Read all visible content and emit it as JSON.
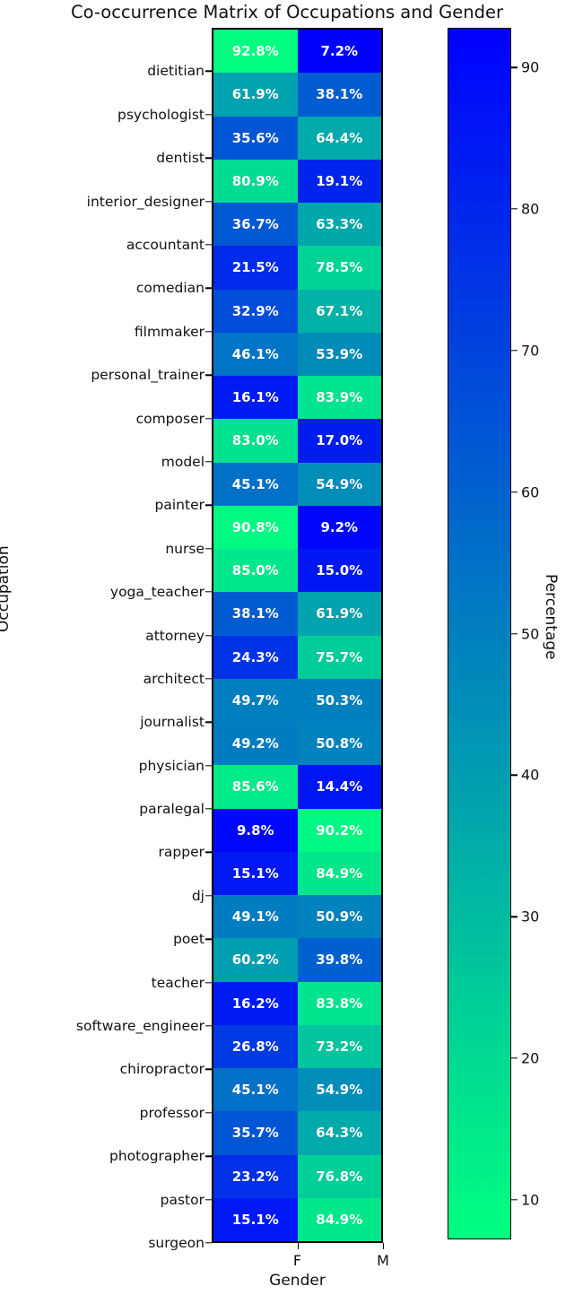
{
  "title": "Co-occurrence Matrix of Occupations and Gender",
  "axes": {
    "xlabel": "Gender",
    "ylabel": "Occupation",
    "colorbar_label": "Percentage"
  },
  "chart_data": {
    "type": "heatmap",
    "title": "Co-occurrence Matrix of Occupations and Gender",
    "xlabel": "Gender",
    "ylabel": "Occupation",
    "colorbar_label": "Percentage",
    "colormap": "winter_r",
    "grid": false,
    "legend_position": "right",
    "vmin": 7.2,
    "vmax": 92.8,
    "colorbar_ticks": [
      90,
      80,
      70,
      60,
      50,
      40,
      30,
      20,
      10
    ],
    "columns": [
      "F",
      "M"
    ],
    "rows": [
      "dietitian",
      "psychologist",
      "dentist",
      "interior_designer",
      "accountant",
      "comedian",
      "filmmaker",
      "personal_trainer",
      "composer",
      "model",
      "painter",
      "nurse",
      "yoga_teacher",
      "attorney",
      "architect",
      "journalist",
      "physician",
      "paralegal",
      "rapper",
      "dj",
      "poet",
      "teacher",
      "software_engineer",
      "chiropractor",
      "professor",
      "photographer",
      "pastor",
      "surgeon"
    ],
    "values": [
      [
        92.8,
        7.2
      ],
      [
        61.9,
        38.1
      ],
      [
        35.6,
        64.4
      ],
      [
        80.9,
        19.1
      ],
      [
        36.7,
        63.3
      ],
      [
        21.5,
        78.5
      ],
      [
        32.9,
        67.1
      ],
      [
        46.1,
        53.9
      ],
      [
        16.1,
        83.9
      ],
      [
        83.0,
        17.0
      ],
      [
        45.1,
        54.9
      ],
      [
        90.8,
        9.2
      ],
      [
        85.0,
        15.0
      ],
      [
        38.1,
        61.9
      ],
      [
        24.3,
        75.7
      ],
      [
        49.7,
        50.3
      ],
      [
        49.2,
        50.8
      ],
      [
        85.6,
        14.4
      ],
      [
        9.8,
        90.2
      ],
      [
        15.1,
        84.9
      ],
      [
        49.1,
        50.9
      ],
      [
        60.2,
        39.8
      ],
      [
        16.2,
        83.8
      ],
      [
        26.8,
        73.2
      ],
      [
        45.1,
        54.9
      ],
      [
        35.7,
        64.3
      ],
      [
        23.2,
        76.8
      ],
      [
        15.1,
        84.9
      ]
    ],
    "cell_labels": [
      [
        "92.8%",
        "7.2%"
      ],
      [
        "61.9%",
        "38.1%"
      ],
      [
        "35.6%",
        "64.4%"
      ],
      [
        "80.9%",
        "19.1%"
      ],
      [
        "36.7%",
        "63.3%"
      ],
      [
        "21.5%",
        "78.5%"
      ],
      [
        "32.9%",
        "67.1%"
      ],
      [
        "46.1%",
        "53.9%"
      ],
      [
        "16.1%",
        "83.9%"
      ],
      [
        "83.0%",
        "17.0%"
      ],
      [
        "45.1%",
        "54.9%"
      ],
      [
        "90.8%",
        "9.2%"
      ],
      [
        "85.0%",
        "15.0%"
      ],
      [
        "38.1%",
        "61.9%"
      ],
      [
        "24.3%",
        "75.7%"
      ],
      [
        "49.7%",
        "50.3%"
      ],
      [
        "49.2%",
        "50.8%"
      ],
      [
        "85.6%",
        "14.4%"
      ],
      [
        "9.8%",
        "90.2%"
      ],
      [
        "15.1%",
        "84.9%"
      ],
      [
        "49.1%",
        "50.9%"
      ],
      [
        "60.2%",
        "39.8%"
      ],
      [
        "16.2%",
        "83.8%"
      ],
      [
        "26.8%",
        "73.2%"
      ],
      [
        "45.1%",
        "54.9%"
      ],
      [
        "35.7%",
        "64.3%"
      ],
      [
        "23.2%",
        "76.8%"
      ],
      [
        "15.1%",
        "84.9%"
      ]
    ]
  }
}
